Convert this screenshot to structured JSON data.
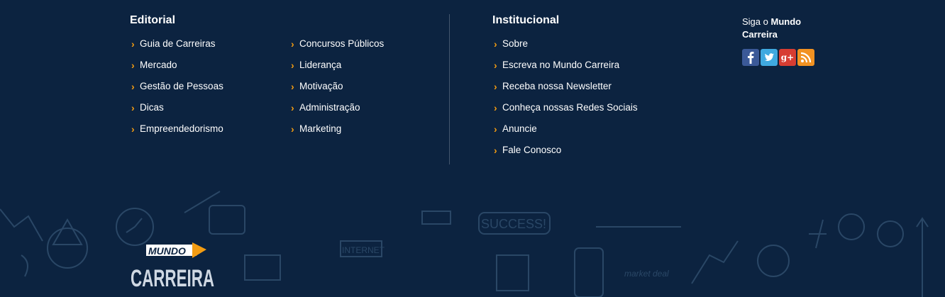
{
  "editorial": {
    "title": "Editorial",
    "col1": [
      "Guia de Carreiras",
      "Mercado",
      "Gestão de Pessoas",
      "Dicas",
      "Empreendedorismo"
    ],
    "col2": [
      "Concursos Públicos",
      "Liderança",
      "Motivação",
      "Administração",
      "Marketing"
    ]
  },
  "institucional": {
    "title": "Institucional",
    "items": [
      "Sobre",
      "Escreva no Mundo Carreira",
      "Receba nossa Newsletter",
      "Conheça nossas Redes Sociais",
      "Anuncie",
      "Fale Conosco"
    ]
  },
  "follow": {
    "prefix": "Siga o ",
    "brand_line1": "Mundo",
    "brand_line2": "Carreira",
    "icons": [
      {
        "name": "facebook-icon",
        "glyph": "f",
        "color": "#3b5998"
      },
      {
        "name": "twitter-icon",
        "glyph": "t",
        "color": "#3fa9e0"
      },
      {
        "name": "googleplus-icon",
        "glyph": "g+",
        "color": "#d73d32"
      },
      {
        "name": "rss-icon",
        "glyph": "rss",
        "color": "#f29222"
      }
    ]
  },
  "logo": {
    "line1": "MUNDO",
    "line2": "CARREIRA"
  },
  "doodles": {
    "success": "SUCCESS!",
    "internet": "INTERNET",
    "market": "market deal"
  },
  "colors": {
    "background": "#0c2340",
    "accent": "#f39c12",
    "divider": "#43566e"
  }
}
